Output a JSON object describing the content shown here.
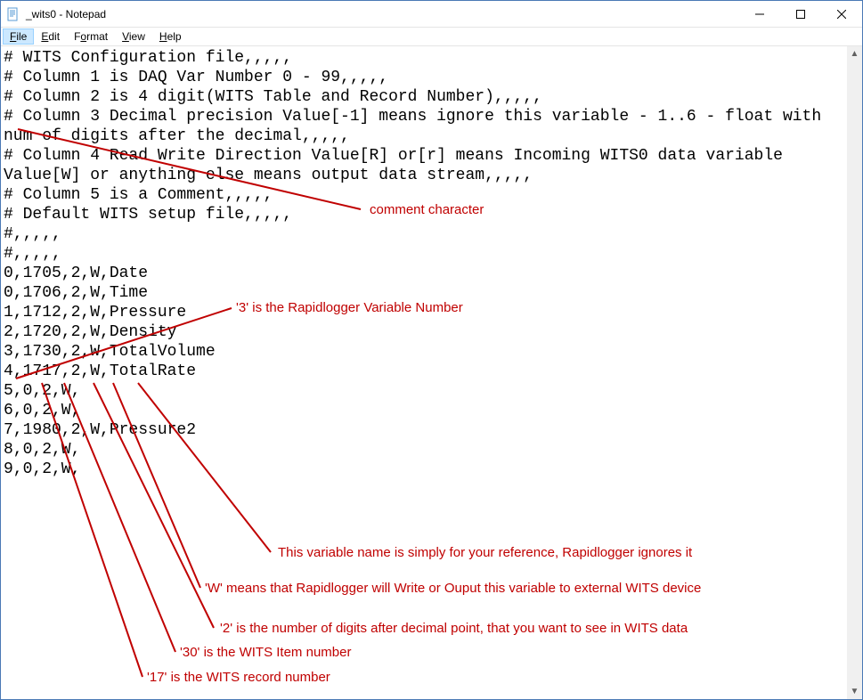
{
  "window_title": "_wits0 - Notepad",
  "menu": {
    "file": "File",
    "edit": "Edit",
    "format": "Format",
    "view": "View",
    "help": "Help"
  },
  "file_lines": [
    "# WITS Configuration file,,,,,",
    "# Column 1 is DAQ Var Number 0 - 99,,,,,",
    "# Column 2 is 4 digit(WITS Table and Record Number),,,,,",
    "# Column 3 Decimal precision Value[-1] means ignore this variable - 1..6 - float with num of digits after the decimal,,,,,",
    "# Column 4 Read Write Direction Value[R] or[r] means Incoming WITS0 data variable Value[W] or anything else means output data stream,,,,,",
    "# Column 5 is a Comment,,,,,",
    "# Default WITS setup file,,,,,",
    "#,,,,,",
    "#,,,,,",
    "0,1705,2,W,Date",
    "0,1706,2,W,Time",
    "1,1712,2,W,Pressure",
    "2,1720,2,W,Density",
    "3,1730,2,W,TotalVolume",
    "4,1717,2,W,TotalRate",
    "5,0,2,W,",
    "6,0,2,W,",
    "7,1980,2,W,Pressure2",
    "8,0,2,W,",
    "9,0,2,W,"
  ],
  "annotations": {
    "comment_character": "comment character",
    "rapidlogger_var": "'3' is the Rapidlogger Variable Number",
    "var_name_reference": "This variable name is simply for your reference, Rapidlogger ignores it",
    "w_means": "'W' means that Rapidlogger will Write or Ouput this variable to external WITS device",
    "two_digits": "'2' is the number of digits after decimal point, that you want to see in WITS data",
    "wits_item": "'30' is the WITS Item number",
    "wits_record": "'17' is the WITS record number"
  }
}
